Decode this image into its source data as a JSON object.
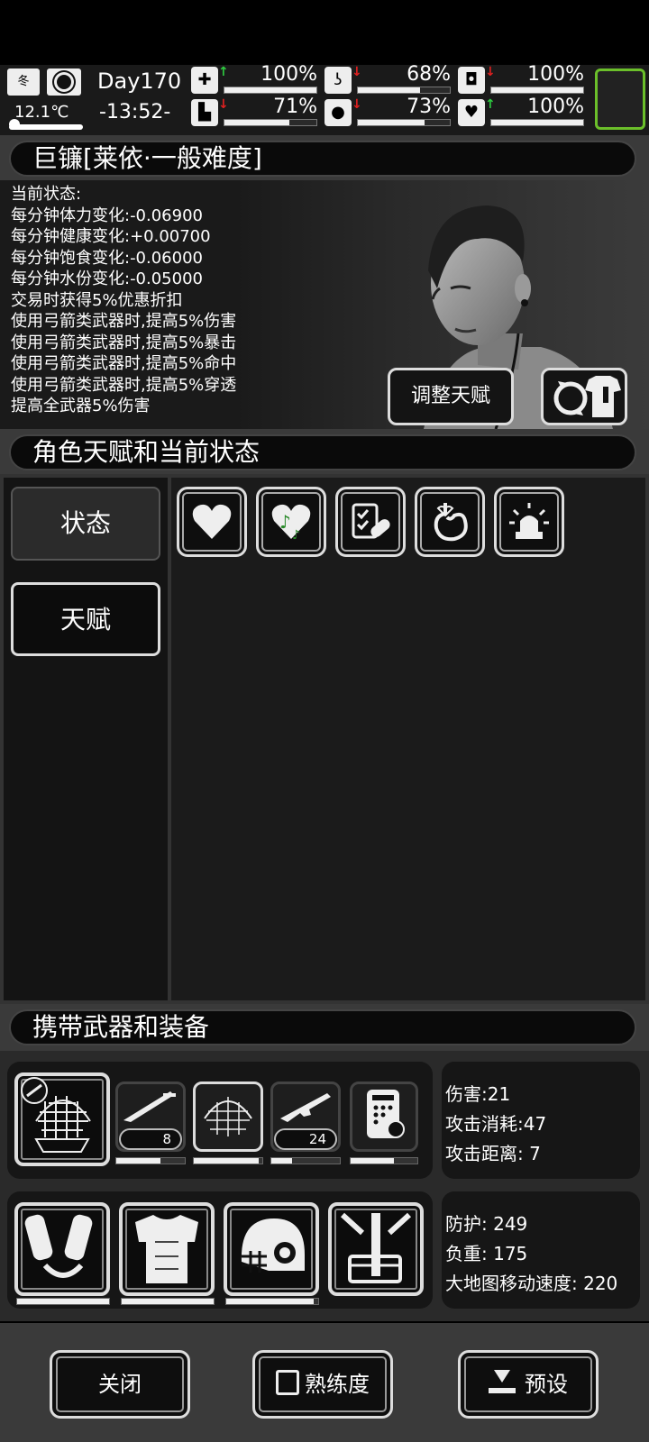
{
  "hud": {
    "season": "冬",
    "temperature": "12.1℃",
    "day": "Day170",
    "time": "-13:52-",
    "meters": [
      {
        "name": "health",
        "icon": "first-aid-icon",
        "trend": "up",
        "value": "100%",
        "fill": 1.0
      },
      {
        "name": "hunger",
        "icon": "stomach-icon",
        "trend": "down",
        "value": "68%",
        "fill": 0.68
      },
      {
        "name": "medicine",
        "icon": "pill-icon",
        "trend": "down",
        "value": "100%",
        "fill": 1.0
      },
      {
        "name": "stamina",
        "icon": "boot-icon",
        "trend": "down",
        "value": "71%",
        "fill": 0.71
      },
      {
        "name": "water",
        "icon": "water-drop-icon",
        "trend": "down",
        "value": "73%",
        "fill": 0.73
      },
      {
        "name": "mood",
        "icon": "heart-icon",
        "trend": "up",
        "value": "100%",
        "fill": 1.0
      }
    ]
  },
  "character": {
    "title": "巨镰[莱依·一般难度]",
    "status_lines": [
      "当前状态:",
      "每分钟体力变化:-0.06900",
      "每分钟健康变化:+0.00700",
      "每分钟饱食变化:-0.06000",
      "每分钟水份变化:-0.05000",
      "交易时获得5%优惠折扣",
      "使用弓箭类武器时,提高5%伤害",
      "使用弓箭类武器时,提高5%暴击",
      "使用弓箭类武器时,提高5%命中",
      "使用弓箭类武器时,提高5%穿透",
      "提高全武器5%伤害"
    ],
    "adjust_talent_label": "调整天赋"
  },
  "status_section": {
    "title": "角色天赋和当前状态",
    "tabs": [
      "状态",
      "天赋"
    ]
  },
  "equipment": {
    "title": "携带武器和装备",
    "ammo": [
      "8",
      "24"
    ],
    "weapon_durability": [
      1.0,
      0.65,
      0.95,
      0.3,
      0.65
    ],
    "armor_durability": [
      1.0,
      1.0,
      0.95
    ],
    "weapon_stats": [
      "伤害:21",
      "攻击消耗:47",
      "攻击距离: 7"
    ],
    "armor_stats": [
      "防护: 249",
      "负重: 175",
      "大地图移动速度: 220"
    ]
  },
  "footer": {
    "close_label": "关闭",
    "proficiency_label": "熟练度",
    "preset_label": "预设"
  },
  "colors": {
    "accent_green": "#6bbf2a",
    "trend_up": "#2ecc40",
    "trend_down": "#e02020"
  }
}
